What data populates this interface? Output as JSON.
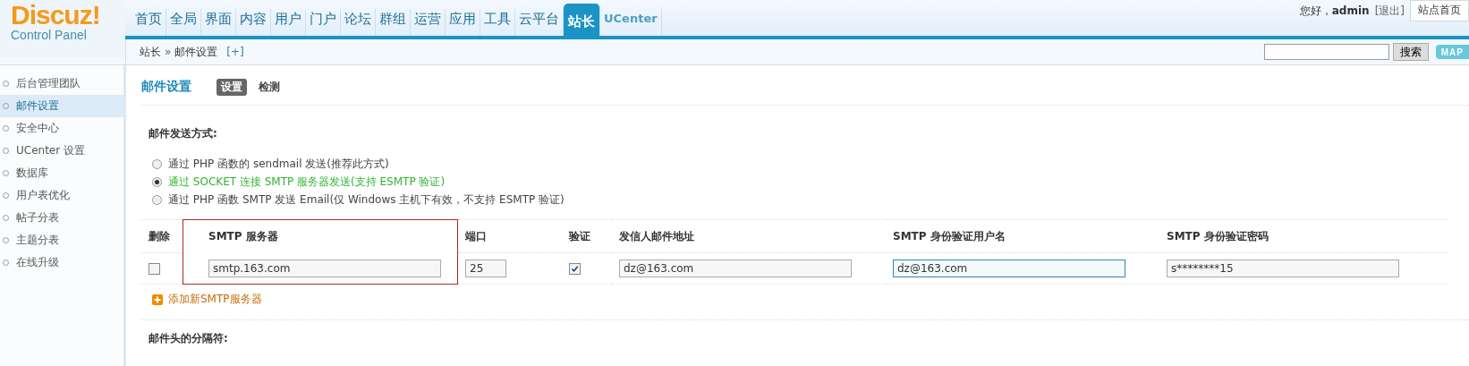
{
  "logo": {
    "title": "Discuz!",
    "subtitle": "Control Panel"
  },
  "nav_tabs": [
    {
      "label": "首页",
      "selected": false
    },
    {
      "label": "全局",
      "selected": false
    },
    {
      "label": "界面",
      "selected": false
    },
    {
      "label": "内容",
      "selected": false
    },
    {
      "label": "用户",
      "selected": false
    },
    {
      "label": "门户",
      "selected": false
    },
    {
      "label": "论坛",
      "selected": false
    },
    {
      "label": "群组",
      "selected": false
    },
    {
      "label": "运营",
      "selected": false
    },
    {
      "label": "应用",
      "selected": false
    },
    {
      "label": "工具",
      "selected": false
    },
    {
      "label": "云平台",
      "selected": false
    },
    {
      "label": "站长",
      "selected": true
    },
    {
      "label": "UCenter",
      "selected": false
    }
  ],
  "user_bar": {
    "greeting": "您好，",
    "username": "admin",
    "logout": "[退出]",
    "site_home": "站点首页"
  },
  "breadcrumb": {
    "parent": "站长",
    "separator": "»",
    "current": "邮件设置",
    "add": "[+]"
  },
  "search": {
    "button": "搜索",
    "map": "MAP"
  },
  "sidebar": {
    "items": [
      {
        "label": "后台管理团队",
        "selected": false
      },
      {
        "label": "邮件设置",
        "selected": true
      },
      {
        "label": "安全中心",
        "selected": false
      },
      {
        "label": "UCenter 设置",
        "selected": false
      },
      {
        "label": "数据库",
        "selected": false
      },
      {
        "label": "用户表优化",
        "selected": false
      },
      {
        "label": "帖子分表",
        "selected": false
      },
      {
        "label": "主题分表",
        "selected": false
      },
      {
        "label": "在线升级",
        "selected": false
      }
    ]
  },
  "page": {
    "title": "邮件设置",
    "subtabs": [
      {
        "label": "设置",
        "selected": true
      },
      {
        "label": "检测",
        "selected": false
      }
    ]
  },
  "send_method": {
    "label": "邮件发送方式:",
    "options": [
      {
        "label": "通过 PHP 函数的 sendmail 发送(推荐此方式)",
        "selected": false
      },
      {
        "label": "通过 SOCKET 连接 SMTP 服务器发送(支持 ESMTP 验证)",
        "selected": true
      },
      {
        "label": "通过 PHP 函数 SMTP 发送 Email(仅 Windows 主机下有效，不支持 ESMTP 验证)",
        "selected": false
      }
    ]
  },
  "smtp_table": {
    "columns": [
      "删除",
      "SMTP 服务器",
      "端口",
      "验证",
      "发信人邮件地址",
      "SMTP 身份验证用户名",
      "SMTP 身份验证密码"
    ],
    "rows": [
      {
        "delete": false,
        "server": "smtp.163.com",
        "port": "25",
        "auth": true,
        "from": "dz@163.com",
        "user": "dz@163.com",
        "user_focused": true,
        "password": "s********15"
      }
    ],
    "add_link": "添加新SMTP服务器"
  },
  "next_section": {
    "label": "邮件头的分隔符:"
  }
}
